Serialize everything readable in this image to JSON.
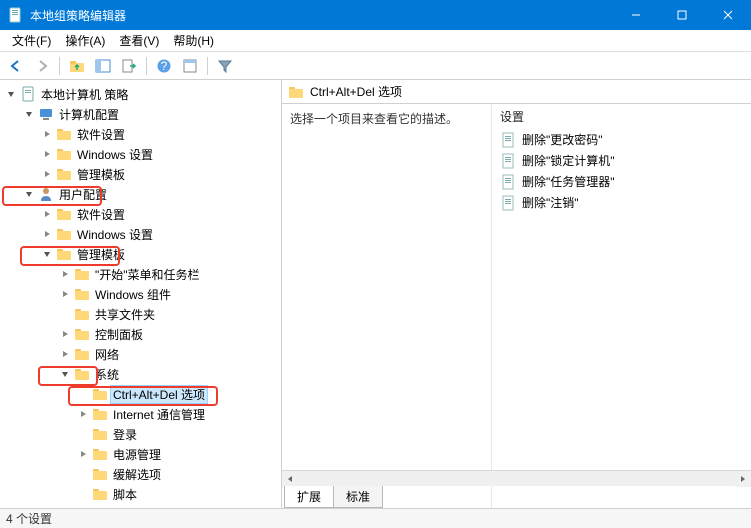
{
  "window": {
    "title": "本地组策略编辑器"
  },
  "menu": {
    "file": "文件(F)",
    "action": "操作(A)",
    "view": "查看(V)",
    "help": "帮助(H)"
  },
  "tree": {
    "root": "本地计算机 策略",
    "computer_config": "计算机配置",
    "cc_software": "软件设置",
    "cc_windows": "Windows 设置",
    "cc_admin": "管理模板",
    "user_config": "用户配置",
    "uc_software": "软件设置",
    "uc_windows": "Windows 设置",
    "uc_admin": "管理模板",
    "start_taskbar": "\"开始\"菜单和任务栏",
    "win_components": "Windows 组件",
    "shared_folders": "共享文件夹",
    "control_panel": "控制面板",
    "network": "网络",
    "system": "系统",
    "ctrlaltdel": "Ctrl+Alt+Del 选项",
    "internet_comm": "Internet 通信管理",
    "logon": "登录",
    "power": "电源管理",
    "mitigation": "缓解选项",
    "scripts": "脚本"
  },
  "right": {
    "header": "Ctrl+Alt+Del 选项",
    "desc": "选择一个项目来查看它的描述。",
    "col_setting": "设置",
    "items": [
      "删除\"更改密码\"",
      "删除\"锁定计算机\"",
      "删除\"任务管理器\"",
      "删除\"注销\""
    ],
    "tab_ext": "扩展",
    "tab_std": "标准"
  },
  "status": "4 个设置"
}
